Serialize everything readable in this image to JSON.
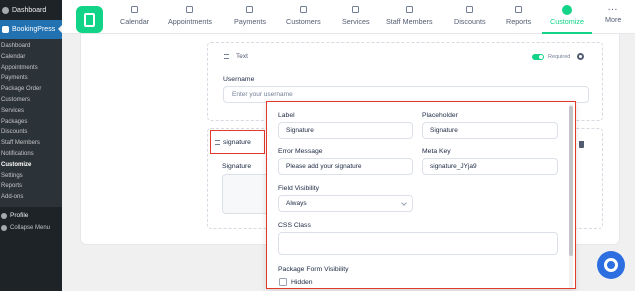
{
  "wp_admin": {
    "dashboard": "Dashboard",
    "plugin": "BookingPress",
    "submenu": [
      "Dashboard",
      "Calendar",
      "Appointments",
      "Payments",
      "Package Order",
      "Customers",
      "Services",
      "Packages",
      "Discounts",
      "Staff Members",
      "Notifications",
      "Customize",
      "Settings",
      "Reports",
      "Add-ons"
    ],
    "current_submenu": "Customize",
    "profile": "Profile",
    "collapse": "Collapse Menu"
  },
  "topnav": {
    "items": [
      {
        "label": "Calendar",
        "icon": "calendar-icon"
      },
      {
        "label": "Appointments",
        "icon": "clock-icon"
      },
      {
        "label": "Payments",
        "icon": "dollar-icon"
      },
      {
        "label": "Customers",
        "icon": "users-icon"
      },
      {
        "label": "Services",
        "icon": "grid-icon"
      },
      {
        "label": "Staff Members",
        "icon": "staff-icon"
      },
      {
        "label": "Discounts",
        "icon": "tag-icon"
      },
      {
        "label": "Reports",
        "icon": "chart-icon"
      },
      {
        "label": "Customize",
        "icon": "palette-icon"
      },
      {
        "label": "More",
        "icon": "more-dots-icon"
      }
    ],
    "active": "Customize"
  },
  "field_card_text": {
    "type": "Text",
    "required_label": "Required",
    "label": "Username",
    "placeholder": "Enter your username",
    "required_on": true
  },
  "field_card_signature": {
    "tag": "signature",
    "label": "Signature"
  },
  "popup": {
    "label_title": "Label",
    "label_value": "Signature",
    "placeholder_title": "Placeholder",
    "placeholder_value": "Signature",
    "error_title": "Error Message",
    "error_value": "Please add your signature",
    "meta_title": "Meta Key",
    "meta_value": "signature_JYja9",
    "visibility_title": "Field Visibility",
    "visibility_value": "Always",
    "css_title": "CSS Class",
    "css_value": "",
    "package_title": "Package Form Visibility",
    "hidden_label": "Hidden"
  },
  "colors": {
    "accent": "#12d488",
    "highlight": "#e23a2a",
    "wp_sidebar": "#1d2327",
    "wp_active": "#2271b1"
  }
}
